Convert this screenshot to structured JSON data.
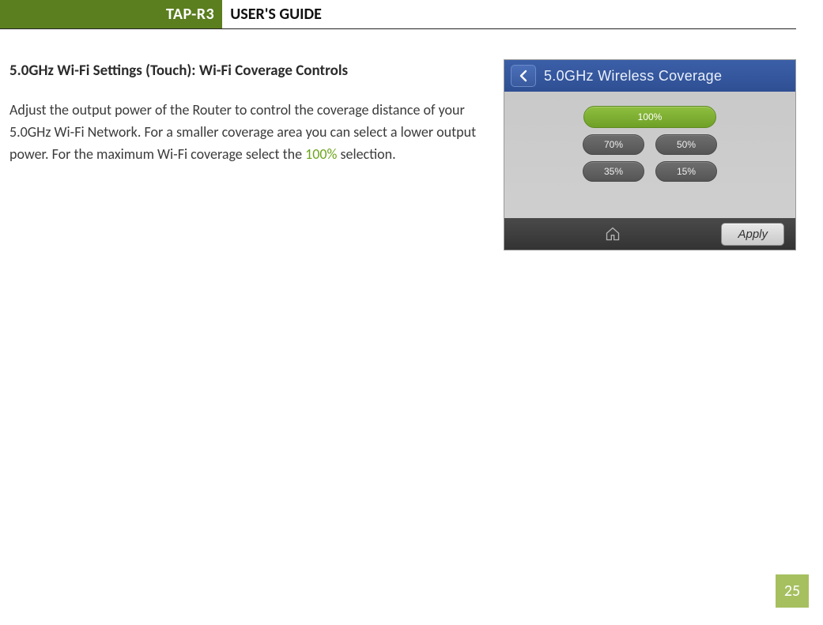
{
  "header": {
    "model": "TAP-R3",
    "title": "USER'S GUIDE"
  },
  "section": {
    "heading": "5.0GHz Wi-Fi Settings (Touch): Wi-Fi Coverage Controls",
    "body_pre": "Adjust the output power of the Router to control the coverage distance of your 5.0GHz Wi-Fi Network. For a smaller coverage area you can select a lower output power. For the maximum Wi-Fi coverage select the ",
    "highlight": "100%",
    "body_post": " selection."
  },
  "device": {
    "title": "5.0GHz Wireless Coverage",
    "selected": "100%",
    "options_row1": [
      "70%",
      "50%"
    ],
    "options_row2": [
      "35%",
      "15%"
    ],
    "apply": "Apply"
  },
  "page_number": "25"
}
